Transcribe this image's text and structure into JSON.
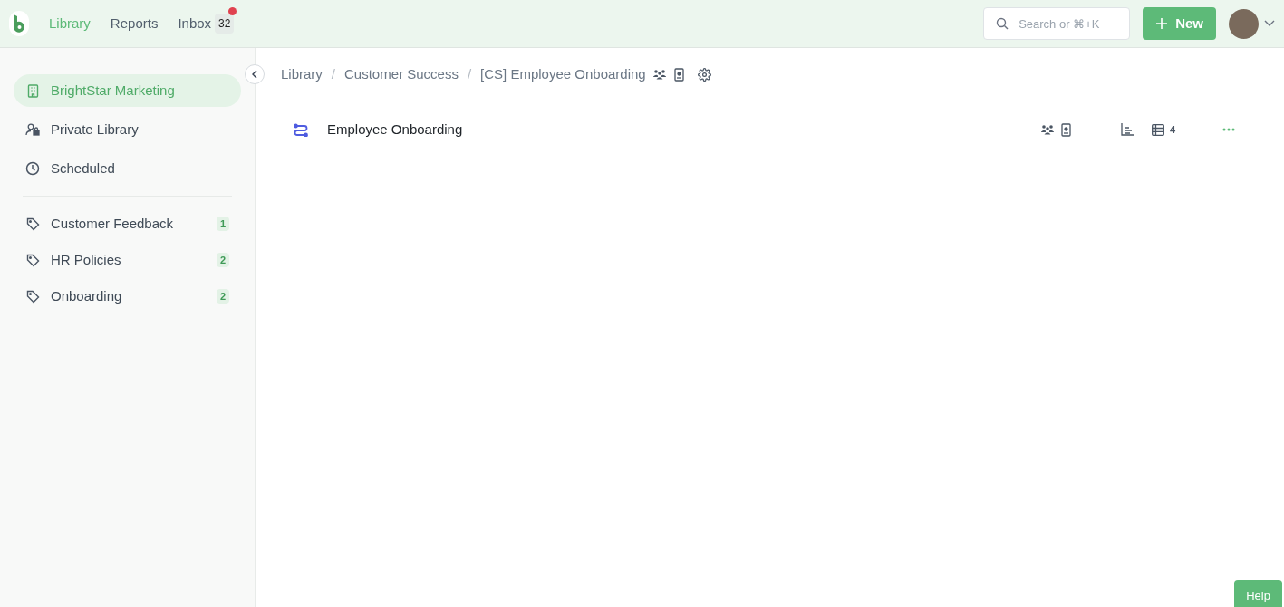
{
  "nav": [
    {
      "label": "Library",
      "selected": true
    },
    {
      "label": "Reports",
      "selected": false
    },
    {
      "label": "Inbox",
      "selected": false,
      "badge": "32",
      "dot": true
    }
  ],
  "search": {
    "placeholder": "Search or ⌘+K"
  },
  "new_button": {
    "label": "New"
  },
  "sidebar": {
    "items": [
      {
        "label": "BrightStar Marketing",
        "kind": "building",
        "selected": true
      },
      {
        "label": "Private Library",
        "kind": "private",
        "selected": false
      },
      {
        "label": "Scheduled",
        "kind": "clock",
        "selected": false
      }
    ],
    "tags": [
      {
        "label": "Customer Feedback",
        "count": "1"
      },
      {
        "label": "HR Policies",
        "count": "2"
      },
      {
        "label": "Onboarding",
        "count": "2"
      }
    ]
  },
  "breadcrumb_separator": "/",
  "breadcrumb": [
    "Library",
    "Customer Success",
    "[CS] Employee Onboarding"
  ],
  "items": [
    {
      "title": "Employee Onboarding",
      "table_count": "4"
    }
  ],
  "help_button": {
    "label": "Help"
  }
}
